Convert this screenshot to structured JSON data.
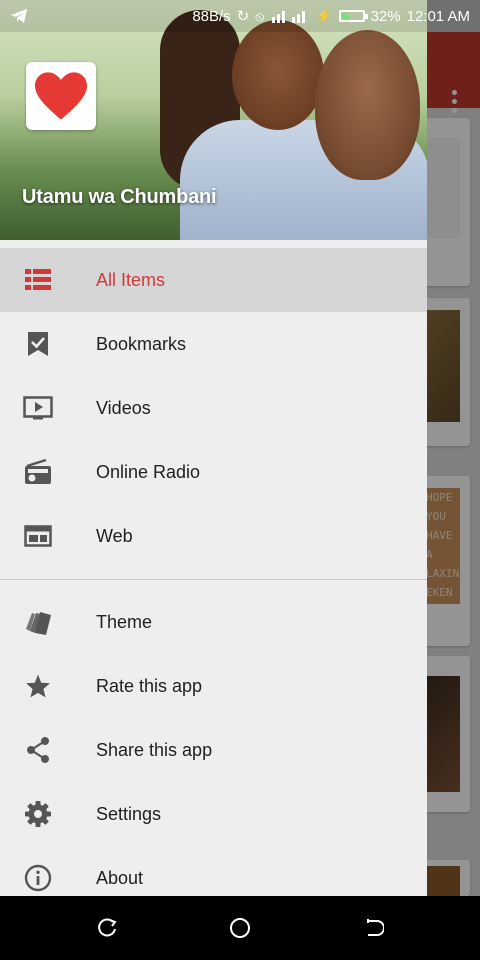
{
  "status_bar": {
    "speed": "88B/s",
    "battery": "32%",
    "time": "12:01 AM",
    "battery_level": 0.32,
    "battery_color": "#7ee07e"
  },
  "drawer": {
    "header": {
      "title": "Utamu wa Chumbani",
      "logo_icon": "heart-icon",
      "logo_color": "#e53935"
    },
    "items": [
      {
        "label": "All Items",
        "icon": "list-icon",
        "active": true
      },
      {
        "label": "Bookmarks",
        "icon": "bookmark-check-icon",
        "active": false
      },
      {
        "label": "Videos",
        "icon": "video-player-icon",
        "active": false
      },
      {
        "label": "Online Radio",
        "icon": "radio-icon",
        "active": false
      },
      {
        "label": "Web",
        "icon": "web-window-icon",
        "active": false
      }
    ],
    "secondary_items": [
      {
        "label": "Theme",
        "icon": "palette-cards-icon"
      },
      {
        "label": "Rate this app",
        "icon": "star-icon"
      },
      {
        "label": "Share this app",
        "icon": "share-icon"
      },
      {
        "label": "Settings",
        "icon": "gear-icon"
      },
      {
        "label": "About",
        "icon": "info-icon"
      }
    ],
    "active_color": "#d0393a"
  },
  "background_app": {
    "card_text": [
      "HOPE",
      "YOU",
      "HAVE",
      "A",
      "LAXIN",
      "EKEN"
    ],
    "toolbar_color": "#c0392b"
  },
  "nav_bar": {
    "icons": [
      "recent-apps-icon",
      "home-icon",
      "back-icon"
    ]
  }
}
